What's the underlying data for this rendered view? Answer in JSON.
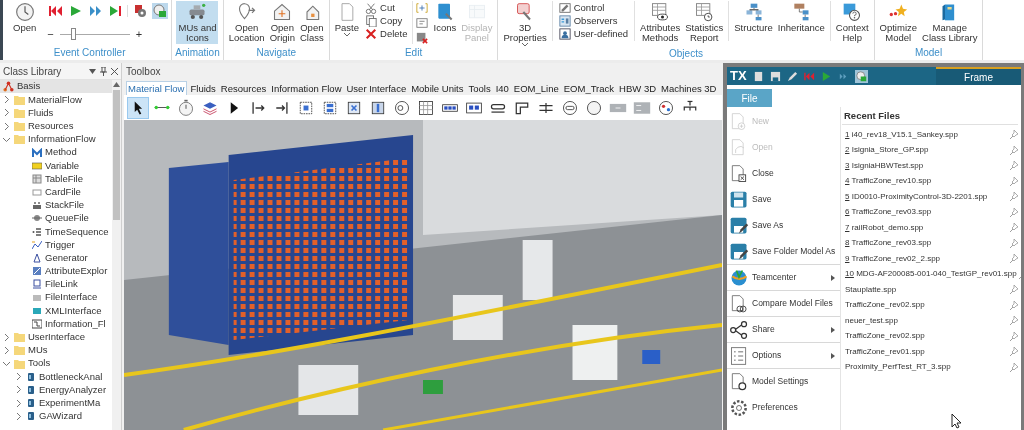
{
  "ribbon": {
    "groups": [
      {
        "label": "Event Controller",
        "items": [
          {
            "kind": "large",
            "label": "Open",
            "selected": false,
            "disabled": false,
            "dropdown": false
          },
          {
            "kind": "controller",
            "buttons": [
              {
                "on": false
              },
              {
                "on": false
              },
              {
                "on": false
              },
              {
                "on": false
              },
              {
                "on": false
              },
              {
                "on": true
              }
            ],
            "minus": "−",
            "plus": "+",
            "slider": {
              "level": 0.18
            }
          }
        ]
      },
      {
        "label": "Animation",
        "items": [
          {
            "kind": "large",
            "label": "MUs and\nIcons",
            "selected": true,
            "disabled": false,
            "dropdown": false
          }
        ]
      },
      {
        "label": "Navigate",
        "items": [
          {
            "kind": "large",
            "label": "Open\nLocation",
            "selected": false,
            "disabled": false,
            "dropdown": false
          },
          {
            "kind": "large",
            "label": "Open\nOrigin",
            "selected": false,
            "disabled": false,
            "dropdown": false
          },
          {
            "kind": "large",
            "label": "Open\nClass",
            "selected": false,
            "disabled": false,
            "dropdown": false
          }
        ]
      },
      {
        "label": "Edit",
        "items": [
          {
            "kind": "large",
            "label": "Paste",
            "selected": false,
            "disabled": false,
            "dropdown": true
          },
          {
            "kind": "stack",
            "entries": [
              "Cut",
              "Copy",
              "Delete"
            ]
          },
          {
            "kind": "icons"
          },
          {
            "kind": "large",
            "label": "Icons",
            "selected": false,
            "disabled": false,
            "dropdown": false
          },
          {
            "kind": "large",
            "label": "Display\nPanel",
            "selected": false,
            "disabled": true,
            "dropdown": false
          }
        ]
      },
      {
        "label": "Objects",
        "items": [
          {
            "kind": "large",
            "label": "3D\nProperties",
            "selected": false,
            "disabled": false,
            "dropdown": true
          },
          {
            "kind": "separator"
          },
          {
            "kind": "stack",
            "entries": [
              "Control",
              "Observers",
              "User-defined"
            ]
          },
          {
            "kind": "separator"
          },
          {
            "kind": "large",
            "label": "Attributes\nMethods",
            "selected": false,
            "disabled": false,
            "dropdown": false
          },
          {
            "kind": "large",
            "label": "Statistics\nReport",
            "selected": false,
            "disabled": false,
            "dropdown": false
          },
          {
            "kind": "separator"
          },
          {
            "kind": "large",
            "label": "Structure",
            "selected": false,
            "disabled": false,
            "dropdown": false
          },
          {
            "kind": "large",
            "label": "Inheritance",
            "selected": false,
            "disabled": false,
            "dropdown": false
          },
          {
            "kind": "separator"
          },
          {
            "kind": "large",
            "label": "Context\nHelp",
            "selected": false,
            "disabled": false,
            "dropdown": false
          }
        ]
      },
      {
        "label": "Model",
        "items": [
          {
            "kind": "large",
            "label": "Optimize\nModel",
            "selected": false,
            "disabled": false,
            "dropdown": false
          },
          {
            "kind": "large",
            "label": "Manage\nClass Library",
            "selected": false,
            "disabled": false,
            "dropdown": false
          }
        ]
      }
    ]
  },
  "class_library": {
    "title": "Class Library",
    "tree": [
      {
        "label": "Basis",
        "selected": true,
        "children": [
          {
            "label": "MaterialFlow",
            "expanded": false,
            "selected": false
          },
          {
            "label": "Fluids",
            "expanded": false,
            "selected": false
          },
          {
            "label": "Resources",
            "expanded": false,
            "selected": false
          },
          {
            "label": "InformationFlow",
            "expanded": true,
            "selected": false,
            "children": [
              {
                "label": "Method",
                "selected": false
              },
              {
                "label": "Variable",
                "selected": false
              },
              {
                "label": "TableFile",
                "selected": false
              },
              {
                "label": "CardFile",
                "selected": false
              },
              {
                "label": "StackFile",
                "selected": false
              },
              {
                "label": "QueueFile",
                "selected": false
              },
              {
                "label": "TimeSequence",
                "selected": false
              },
              {
                "label": "Trigger",
                "selected": false
              },
              {
                "label": "Generator",
                "selected": false
              },
              {
                "label": "AttributeExplor",
                "selected": false
              },
              {
                "label": "FileLink",
                "selected": false
              },
              {
                "label": "FileInterface",
                "selected": false
              },
              {
                "label": "XMLInterface",
                "selected": false
              },
              {
                "label": "Information_Fl",
                "selected": false
              }
            ]
          },
          {
            "label": "UserInterface",
            "expanded": false,
            "selected": false
          },
          {
            "label": "MUs",
            "expanded": false,
            "selected": false
          },
          {
            "label": "Tools",
            "expanded": true,
            "selected": false,
            "children": [
              {
                "label": "BottleneckAnal",
                "expanded": false,
                "selected": false
              },
              {
                "label": "EnergyAnalyzer",
                "expanded": false,
                "selected": false
              },
              {
                "label": "ExperimentMa",
                "expanded": false,
                "selected": false
              },
              {
                "label": "GAWizard",
                "expanded": false,
                "selected": false
              }
            ]
          }
        ]
      }
    ]
  },
  "toolbox": {
    "title": "Toolbox",
    "tabs": [
      {
        "label": "Material Flow",
        "selected": true
      },
      {
        "label": "Fluids",
        "selected": false
      },
      {
        "label": "Resources",
        "selected": false
      },
      {
        "label": "Information Flow",
        "selected": false
      },
      {
        "label": "User Interface",
        "selected": false
      },
      {
        "label": "Mobile Units",
        "selected": false
      },
      {
        "label": "Tools",
        "selected": false
      },
      {
        "label": "I40",
        "selected": false
      },
      {
        "label": "EOM_Line",
        "selected": false
      },
      {
        "label": "EOM_Track",
        "selected": false
      },
      {
        "label": "HBW 3D",
        "selected": false
      },
      {
        "label": "Machines 3D",
        "selected": false
      }
    ],
    "tools": [
      {
        "selected": true
      },
      {
        "selected": false
      },
      {
        "selected": false
      },
      {
        "selected": false
      },
      {
        "selected": false
      },
      {
        "selected": false
      },
      {
        "selected": false
      },
      {
        "selected": false
      },
      {
        "selected": false
      },
      {
        "selected": false
      },
      {
        "selected": false
      },
      {
        "selected": false
      },
      {
        "selected": false
      },
      {
        "selected": false
      },
      {
        "selected": false
      },
      {
        "selected": false
      },
      {
        "selected": false
      },
      {
        "selected": false
      },
      {
        "selected": false
      },
      {
        "selected": false
      },
      {
        "selected": false
      },
      {
        "selected": false
      },
      {
        "selected": false
      },
      {
        "selected": false
      }
    ]
  },
  "file_window": {
    "logo": "TX",
    "title": "Frame",
    "tabs": [
      {
        "label": "File",
        "selected": true
      }
    ],
    "menu": [
      {
        "label": "New",
        "disabled": true,
        "submenu": false,
        "separator_below": false
      },
      {
        "label": "Open",
        "disabled": true,
        "submenu": false,
        "separator_below": false
      },
      {
        "label": "Close",
        "disabled": false,
        "submenu": false,
        "separator_below": false
      },
      {
        "label": "Save",
        "disabled": false,
        "submenu": false,
        "separator_below": false
      },
      {
        "label": "Save As",
        "disabled": false,
        "submenu": false,
        "separator_below": false
      },
      {
        "label": "Save Folder Model As",
        "disabled": false,
        "submenu": false,
        "separator_below": true
      },
      {
        "label": "Teamcenter",
        "disabled": false,
        "submenu": true,
        "separator_below": true
      },
      {
        "label": "Compare Model Files",
        "disabled": false,
        "submenu": false,
        "separator_below": true
      },
      {
        "label": "Share",
        "disabled": false,
        "submenu": true,
        "separator_below": true
      },
      {
        "label": "Options",
        "disabled": false,
        "submenu": true,
        "separator_below": true
      },
      {
        "label": "Model Settings",
        "disabled": false,
        "submenu": false,
        "separator_below": false
      },
      {
        "label": "Preferences",
        "disabled": false,
        "submenu": false,
        "separator_below": false
      }
    ],
    "recent": {
      "heading": "Recent Files",
      "files": [
        {
          "number": "1",
          "name": "i40_rev18_V15.1_Sankey.spp"
        },
        {
          "number": "2",
          "name": "Isignia_Store_GP.spp"
        },
        {
          "number": "3",
          "name": "IsigniaHBWTest.spp"
        },
        {
          "number": "4",
          "name": "TrafficZone_rev10.spp"
        },
        {
          "number": "5",
          "name": "ID0010-ProximityControl-3D-2201.spp"
        },
        {
          "number": "6",
          "name": "TrafficZone_rev03.spp"
        },
        {
          "number": "7",
          "name": "railRobot_demo.spp"
        },
        {
          "number": "8",
          "name": "TrafficZone_rev03.spp"
        },
        {
          "number": "9",
          "name": "TrafficZone_rev02_2.spp"
        },
        {
          "number": "10",
          "name": "MDG-AF200085-001-040_TestGP_rev01.spp"
        },
        {
          "name": "Stauplatte.spp"
        },
        {
          "name": "TrafficZone_rev02.spp"
        },
        {
          "name": "neuer_test.spp"
        },
        {
          "name": "TrafficZone_rev02.spp"
        },
        {
          "name": "TrafficZone_rev01.spp"
        },
        {
          "name": "Proximity_PerfTest_RT_3.spp"
        }
      ]
    }
  }
}
